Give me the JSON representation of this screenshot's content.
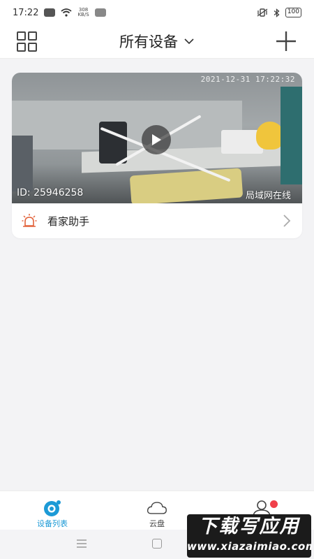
{
  "status_bar": {
    "time": "17:22",
    "net_speed_value": "308",
    "net_speed_unit": "KB/S",
    "battery": "100"
  },
  "header": {
    "title": "所有设备"
  },
  "device": {
    "timestamp": "2021-12-31  17:22:32",
    "id_label": "ID: 25946258",
    "status": "局域网在线",
    "assistant_label": "看家助手"
  },
  "tabs": [
    {
      "label": "设备列表",
      "icon": "camera-icon",
      "active": true
    },
    {
      "label": "云盘",
      "icon": "cloud-icon",
      "active": false
    },
    {
      "label": "",
      "icon": "user-icon",
      "active": false,
      "badge": true
    }
  ],
  "watermark": {
    "main": "下载写应用",
    "sub": "www.xiazaimiao.com"
  },
  "colors": {
    "accent": "#1c9ad6",
    "alarm": "#e2623a",
    "badge": "#f0404a"
  }
}
